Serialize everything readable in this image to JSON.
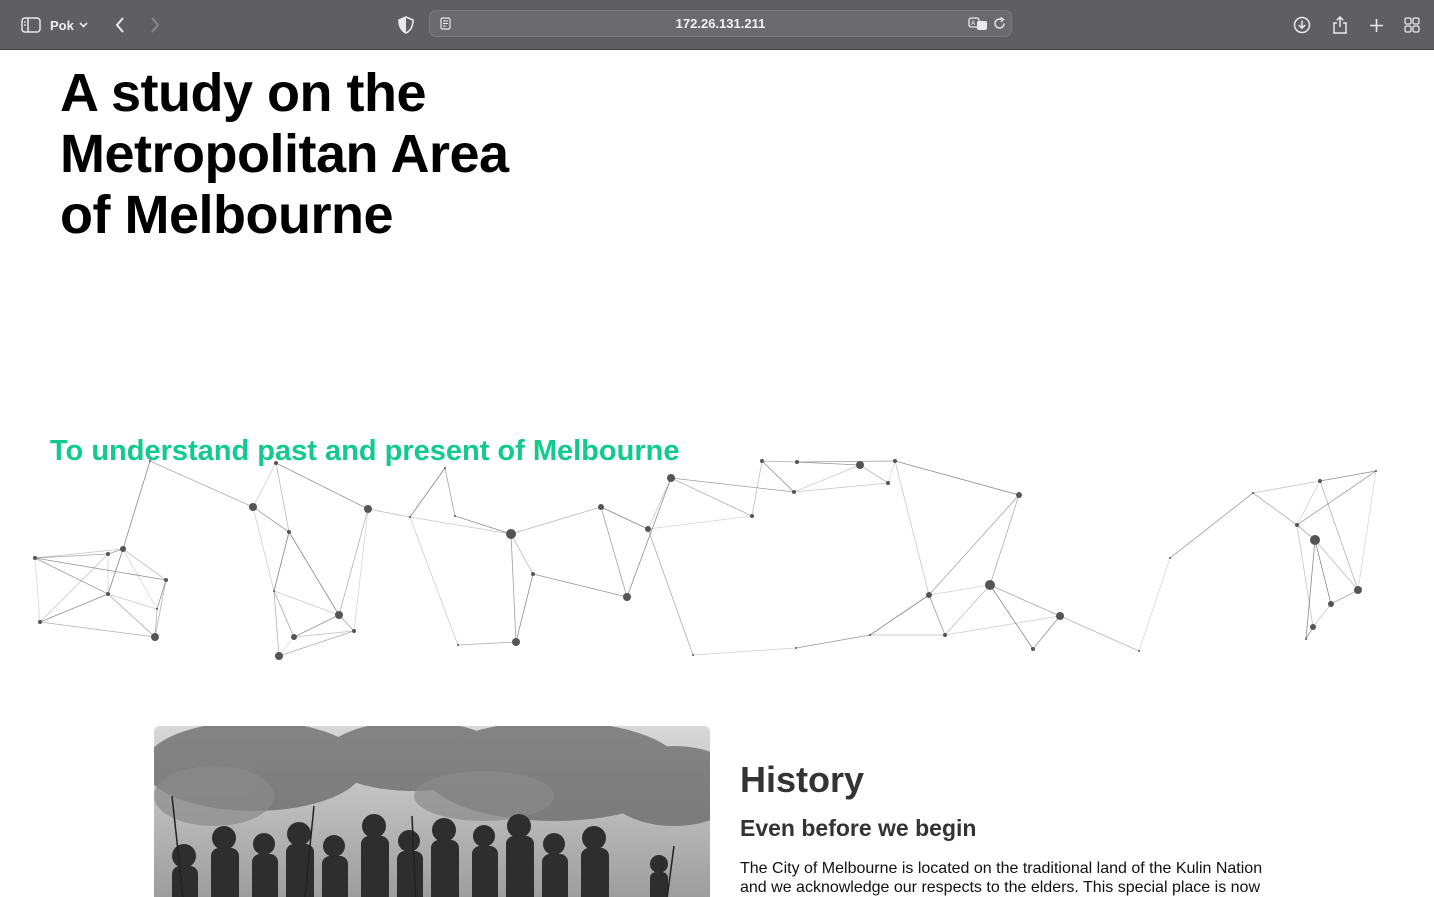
{
  "browser": {
    "profile_name": "Pok",
    "url": "172.26.131.211",
    "icons": [
      "sidebar-icon",
      "chevron-down-icon",
      "back-icon",
      "forward-icon",
      "shield-icon",
      "page-icon",
      "translate-icon",
      "reload-icon",
      "download-icon",
      "share-icon",
      "plus-icon",
      "tab-overview-icon"
    ]
  },
  "hero": {
    "title": "A study on the Metropolitan Area of Melbourne"
  },
  "tagline": "To understand past and present of Melbourne",
  "colors": {
    "accent": "#12c98e",
    "toolbar": "#5f5e63"
  },
  "history": {
    "title": "History",
    "subtitle": "Even before we begin",
    "text": "The City of Melbourne is located on the traditional land of the Kulin Nation and we acknowledge our respects to the elders. This special place is now"
  }
}
